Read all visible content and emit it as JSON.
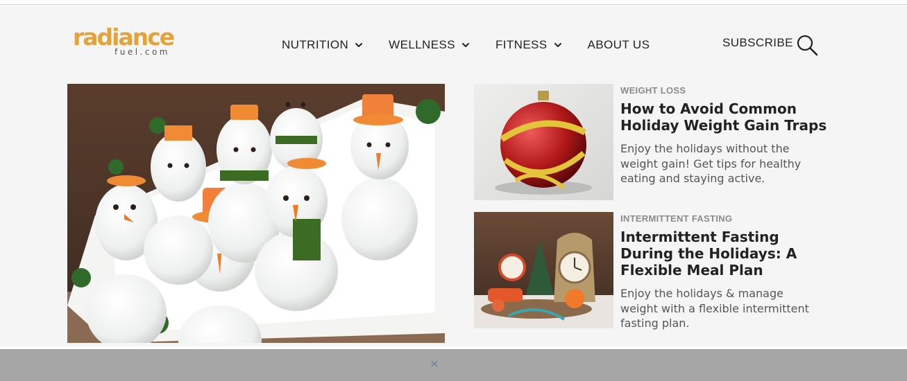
{
  "site": {
    "brand": "radiance",
    "brand_sub": "fuel.com",
    "brand_color": "#e3a33a"
  },
  "nav": {
    "items": [
      {
        "label": "NUTRITION",
        "has_dropdown": true
      },
      {
        "label": "WELLNESS",
        "has_dropdown": true
      },
      {
        "label": "FITNESS",
        "has_dropdown": true
      },
      {
        "label": "ABOUT US",
        "has_dropdown": false
      }
    ],
    "subscribe_label": "SUBSCRIBE",
    "search_icon": "search-icon"
  },
  "hero": {
    "image": "snowman-eggs-photo"
  },
  "articles": [
    {
      "category": "WEIGHT LOSS",
      "title": "How to Avoid Common Holiday Weight Gain Traps",
      "description": "Enjoy the holidays without the weight gain! Get tips for healthy eating and staying active.",
      "image": "ornament-measuring-tape-photo"
    },
    {
      "category": "INTERMITTENT FASTING",
      "title": "Intermittent Fasting During the Holidays: A Flexible Meal Plan",
      "description": "Enjoy the holidays & manage weight with a flexible intermittent fasting plan.",
      "image": "holiday-clock-tree-photo"
    }
  ],
  "ad_bar": {
    "close_icon": "close-icon"
  }
}
